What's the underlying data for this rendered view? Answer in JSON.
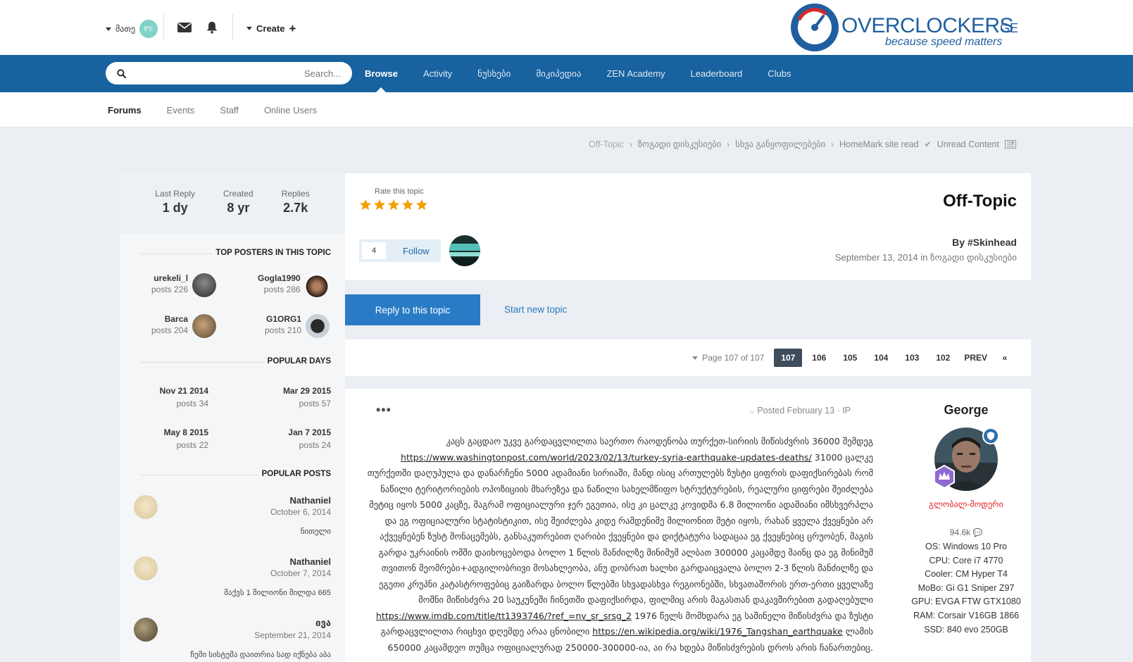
{
  "header": {
    "user_label": "მათე",
    "avatar_text": "ᏛᎬ",
    "create_label": "Create",
    "logo_brand": "OVERCLOCKERS",
    "logo_suffix": "GE",
    "logo_tagline": "because speed matters"
  },
  "navbar": {
    "search_placeholder": "Search...",
    "items": [
      "Browse",
      "Activity",
      "ნუსხები",
      "მიკიპედია",
      "ZEN Academy",
      "Leaderboard",
      "Clubs"
    ]
  },
  "subnav": {
    "items": [
      "Forums",
      "Events",
      "Staff",
      "Online Users"
    ]
  },
  "breadcrumb": {
    "items": [
      "Off-Topic",
      "ზოგადი დისკუსიები",
      "სხვა განყოფილებები",
      "HomeMark site read",
      "Unread Content"
    ]
  },
  "sidebar": {
    "stats": [
      {
        "label": "Last Reply",
        "value": "1 dy"
      },
      {
        "label": "Created",
        "value": "8 yr"
      },
      {
        "label": "Replies",
        "value": "2.7k"
      }
    ],
    "top_posters_title": "TOP POSTERS IN THIS TOPIC",
    "top_posters": [
      {
        "name": "Gogla1990",
        "count": "posts 286"
      },
      {
        "name": "urekeli_l",
        "count": "posts 226"
      },
      {
        "name": "G1ORG1",
        "count": "posts 210"
      },
      {
        "name": "Barca",
        "count": "posts 204"
      }
    ],
    "popular_days_title": "POPULAR DAYS",
    "popular_days": [
      {
        "date": "Mar 29 2015",
        "count": "posts 57"
      },
      {
        "date": "Nov 21 2014",
        "count": "posts 34"
      },
      {
        "date": "Jan 7 2015",
        "count": "posts 24"
      },
      {
        "date": "May 8 2015",
        "count": "posts 22"
      }
    ],
    "popular_posts_title": "POPULAR POSTS",
    "popular_posts": [
      {
        "author": "Nathaniel",
        "date": "October 6, 2014",
        "excerpt": "ნითელი"
      },
      {
        "author": "Nathaniel",
        "date": "October 7, 2014",
        "excerpt": "მაქვს 1 მილიონი მილდა 665"
      },
      {
        "author": "ივა",
        "date": "September 21, 2014",
        "excerpt": "ჩემი სისტემა დაითრია სად იქნება აბა"
      }
    ]
  },
  "topic": {
    "rate_label": "Rate this topic",
    "rating": 5,
    "rating_max": 5,
    "title": "Off-Topic",
    "follow_count": "4",
    "follow_label": "Follow",
    "by_line": "By #Skinhead",
    "started": "September 13, 2014 in ზოგადი დისკუსიები"
  },
  "actions": {
    "reply": "Reply to this topic",
    "new_topic": "Start new topic"
  },
  "pagination": {
    "label": "Page 107 of 107",
    "pages": [
      "107",
      "106",
      "105",
      "104",
      "103",
      "102",
      "PREV",
      "«"
    ],
    "current": "107"
  },
  "post": {
    "more": "•••",
    "posted": "Posted February 13 · IP",
    "body_1": "კაცს გაცდაო უკვე გარდაცვლილთა საერთო რაოდენობა თურქეთ-სირიის მიწისძვრის 36000 შემდეგ ",
    "link_1": "https://www.washingtonpost.com/world/2023/02/13/turkey-syria-earthquake-updates-deaths/",
    "body_2": " 31000 ცალკე თურქეთში დაღუპულა და დანარჩენი 5000 ადამიანი სირიაში, მანდ ისიც ართულებს ზუსტი ციფრის დაფიქსირებას რომ ნაწილი ტერიტორიების ოპოზიციის მხარეზეა და ნაწილი სახელმწიფო სტრუქტურების, რეალური ციფრები შეიძლება მეტიც იყოს 5000 კაცზე, მაგრამ ოფიციალური ჯერ ეგეთია, ისე კი ცალკე კოვიდმა 6.8 მილიონი ადამიანი იმსხვერპლა და ეგ ოფიციალური სტატისტიკით, ისე შეიძლება კიდე რამდენიმე მილიონით მეტი იყოს, რახან ყველა ქვეყნები არ აქვეყნებენ ზუსტ მონაცემებს, განსაკუთრებით ღარიბი ქვეყნები და დიქტატურა სადაცაა ეგ ქვეყნებიც ცრუობენ, მაგის გარდა უკრაინის ომში დაიხოცებოდა ბოლო 1 წლის მანძილზე მინიმუმ ალბათ 300000 კაცამდე მაინც და ეგ მინიმუმ თვითონ მეომრები+ადგილობრივი მოსახლეობა, ანუ დობრათ ხალხი გარდაიცვალა ბოლო 2-3 წლის მანძილზე და ეგეთი კრუპნი კატასტროფებიც გაიზარდა ბოლო წლებში სხვადასხვა რეგიონებში, სხვათაშორის ერთ-ერთი ყველაზე მოშნი მიწისძვრა 20 საუკუნეში ჩინეთში დაფიქსირდა, ფილმიც არის მაგასთან დაკავშირებით გადაღებული ",
    "link_2": "https://www.imdb.com/title/tt1393746/?ref_=nv_sr_srsg_2",
    "body_3": " 1976 წელს მომხდარა ეგ საშინელი მიწისძვრა და ზუსტი გარდაცვლილთა რიცხვი დღემდე არაა ცნობილი ",
    "link_3": "https://en.wikipedia.org/wiki/1976_Tangshan_earthquake",
    "body_4": " ლამის 650000 კაცამდეო თუმცა ოფიციალურად 250000-300000-ია, აი რა ხდება მიწისძვრების დროს არის ჩანართებიც.",
    "author": {
      "name": "George",
      "group": "გლობალ-მოდერი",
      "reputation": "94.6k",
      "specs": [
        "OS: Windows 10 Pro",
        "CPU: Core i7 4770",
        "Cooler: CM Hyper T4",
        "MoBo: Gi G1 Sniper Z97",
        "GPU: EVGA FTW GTX1080",
        "RAM: Corsair V16GB 1866",
        "SSD: 840 evo 250GB"
      ]
    }
  },
  "colors": {
    "navbar": "#17629f",
    "accent": "#2a7bc6",
    "star": "#f0a000",
    "group": "#e02020"
  }
}
